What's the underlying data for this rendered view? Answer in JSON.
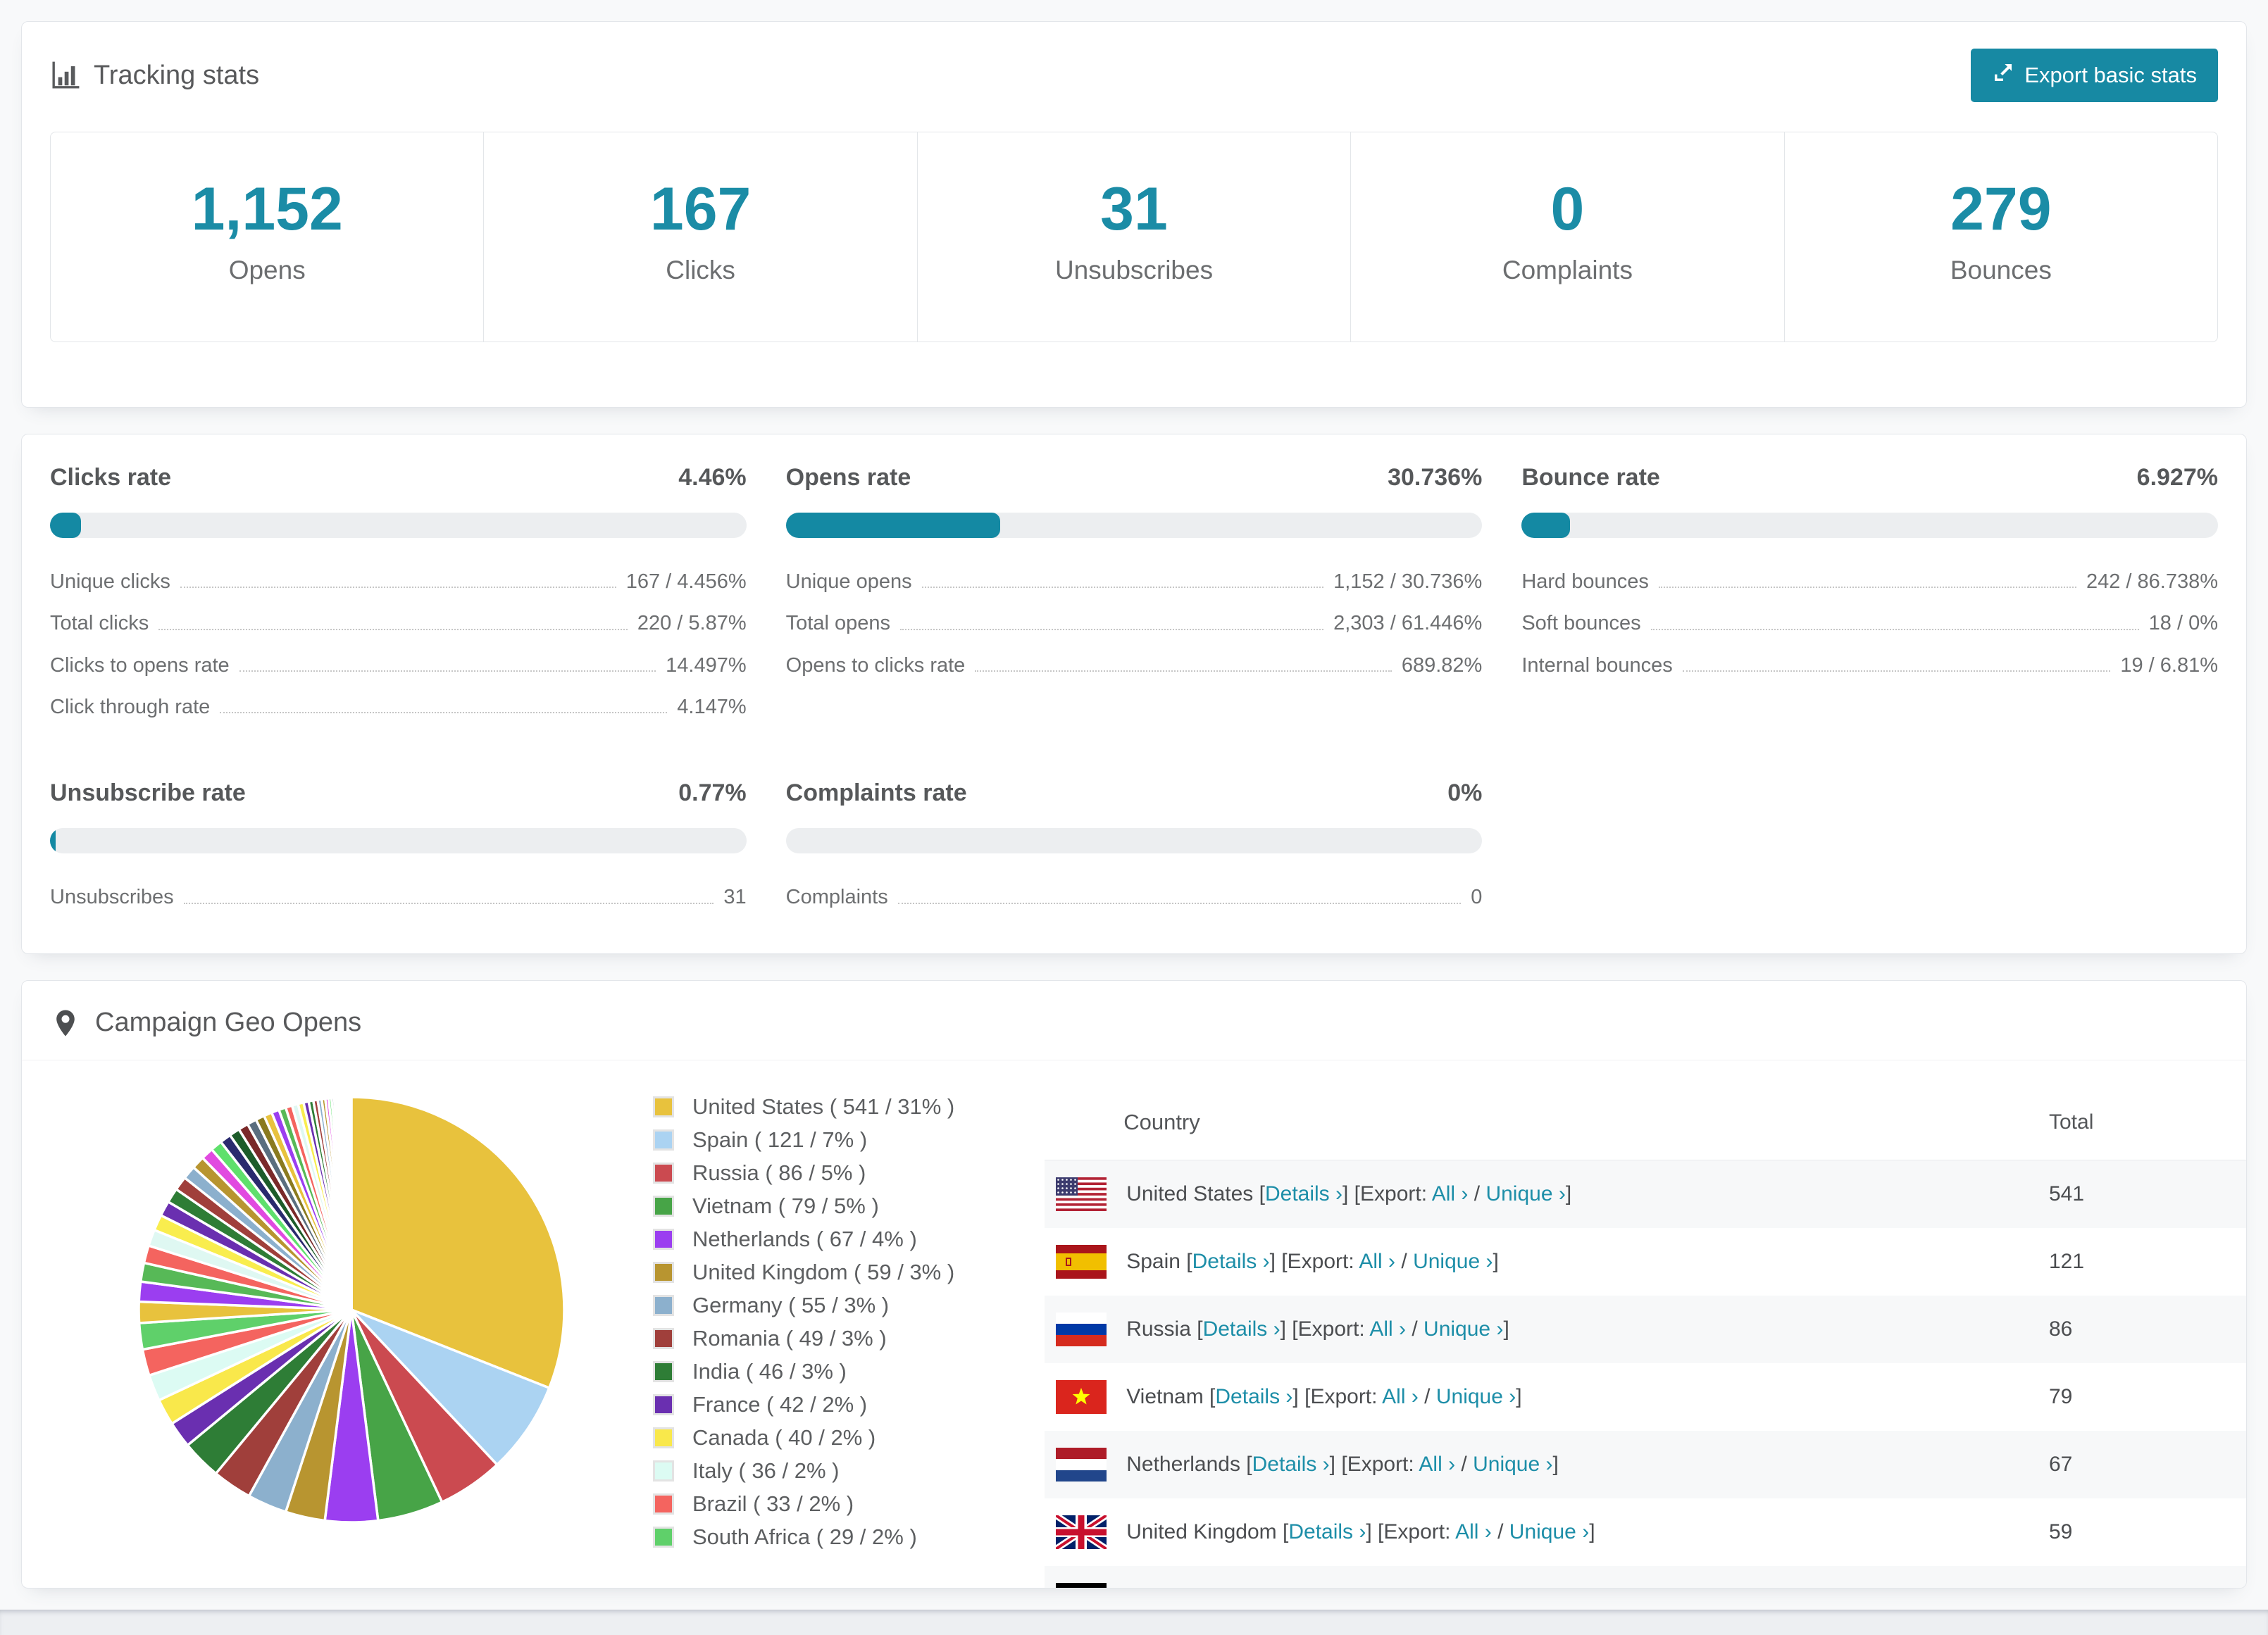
{
  "accent": "#1789a3",
  "tracking": {
    "title": "Tracking stats",
    "export_button": "Export basic stats",
    "summary": [
      {
        "value": "1,152",
        "label": "Opens"
      },
      {
        "value": "167",
        "label": "Clicks"
      },
      {
        "value": "31",
        "label": "Unsubscribes"
      },
      {
        "value": "0",
        "label": "Complaints"
      },
      {
        "value": "279",
        "label": "Bounces"
      }
    ]
  },
  "rates": [
    {
      "title": "Clicks rate",
      "value": "4.46%",
      "percent": 4.46,
      "rows": [
        {
          "label": "Unique clicks",
          "value": "167 / 4.456%"
        },
        {
          "label": "Total clicks",
          "value": "220 / 5.87%"
        },
        {
          "label": "Clicks to opens rate",
          "value": "14.497%"
        },
        {
          "label": "Click through rate",
          "value": "4.147%"
        }
      ]
    },
    {
      "title": "Opens rate",
      "value": "30.736%",
      "percent": 30.736,
      "rows": [
        {
          "label": "Unique opens",
          "value": "1,152 / 30.736%"
        },
        {
          "label": "Total opens",
          "value": "2,303 / 61.446%"
        },
        {
          "label": "Opens to clicks rate",
          "value": "689.82%"
        }
      ]
    },
    {
      "title": "Bounce rate",
      "value": "6.927%",
      "percent": 6.927,
      "rows": [
        {
          "label": "Hard bounces",
          "value": "242 / 86.738%"
        },
        {
          "label": "Soft bounces",
          "value": "18 / 0%"
        },
        {
          "label": "Internal bounces",
          "value": "19 / 6.81%"
        }
      ]
    },
    {
      "title": "Unsubscribe rate",
      "value": "0.77%",
      "percent": 0.77,
      "rows": [
        {
          "label": "Unsubscribes",
          "value": "31"
        }
      ]
    },
    {
      "title": "Complaints rate",
      "value": "0%",
      "percent": 0,
      "rows": [
        {
          "label": "Complaints",
          "value": "0"
        }
      ]
    }
  ],
  "geo": {
    "title": "Campaign Geo Opens",
    "columns": {
      "country": "Country",
      "total": "Total"
    },
    "links": {
      "open": " [",
      "close": "]",
      "details": "Details ›",
      "export": "Export: ",
      "all": "All ›",
      "sep": " / ",
      "unique": "Unique ›"
    },
    "rows": [
      {
        "country": "United States",
        "flag": "us",
        "total": "541",
        "partial": false
      },
      {
        "country": "Spain",
        "flag": "es",
        "total": "121",
        "partial": false
      },
      {
        "country": "Russia",
        "flag": "ru",
        "total": "86",
        "partial": false
      },
      {
        "country": "Vietnam",
        "flag": "vn",
        "total": "79",
        "partial": false
      },
      {
        "country": "Netherlands",
        "flag": "nl",
        "total": "67",
        "partial": false
      },
      {
        "country": "United Kingdom",
        "flag": "gb",
        "total": "59",
        "partial": false
      },
      {
        "country": "",
        "flag": "de",
        "total": "",
        "partial": true
      }
    ]
  },
  "chart_data": {
    "type": "pie",
    "title": "Campaign Geo Opens",
    "start_angle_deg": 0,
    "direction": "clockwise",
    "legend_position": "right",
    "slices": [
      {
        "label": "United States",
        "count": 541,
        "pct": 31,
        "color": "#e8c23d"
      },
      {
        "label": "Spain",
        "count": 121,
        "pct": 7,
        "color": "#abd3f2"
      },
      {
        "label": "Russia",
        "count": 86,
        "pct": 5,
        "color": "#cb4a50"
      },
      {
        "label": "Vietnam",
        "count": 79,
        "pct": 5,
        "color": "#47a447"
      },
      {
        "label": "Netherlands",
        "count": 67,
        "pct": 4,
        "color": "#9b3ef0"
      },
      {
        "label": "United Kingdom",
        "count": 59,
        "pct": 3,
        "color": "#b89530"
      },
      {
        "label": "Germany",
        "count": 55,
        "pct": 3,
        "color": "#8cb0cd"
      },
      {
        "label": "Romania",
        "count": 49,
        "pct": 3,
        "color": "#a03f3b"
      },
      {
        "label": "India",
        "count": 46,
        "pct": 3,
        "color": "#2e7d36"
      },
      {
        "label": "France",
        "count": 42,
        "pct": 2,
        "color": "#6a2fb0"
      },
      {
        "label": "Canada",
        "count": 40,
        "pct": 2,
        "color": "#f9e84b"
      },
      {
        "label": "Italy",
        "count": 36,
        "pct": 2,
        "color": "#dcfbf3"
      },
      {
        "label": "Brazil",
        "count": 33,
        "pct": 2,
        "color": "#f4645f"
      },
      {
        "label": "South Africa",
        "count": 29,
        "pct": 2,
        "color": "#5fd06a"
      }
    ],
    "others": {
      "note": "many unlabeled small-country slices totaling ~26% of opens",
      "weights": [
        1.8,
        1.7,
        1.6,
        1.5,
        1.4,
        1.35,
        1.3,
        1.25,
        1.2,
        1.15,
        1.1,
        1.05,
        1.0,
        0.95,
        0.9,
        0.85,
        0.8,
        0.75,
        0.7,
        0.65,
        0.6,
        0.56,
        0.52,
        0.48,
        0.44,
        0.4,
        0.37,
        0.34,
        0.31,
        0.28,
        0.25,
        0.22,
        0.2,
        0.18,
        0.16,
        0.14,
        0.12,
        0.1,
        0.09,
        0.08,
        0.07,
        0.06,
        0.05,
        0.045,
        0.04,
        0.035,
        0.03,
        0.025,
        0.02,
        0.015
      ],
      "colors": [
        "#e8c23d",
        "#9b3ef0",
        "#57b957",
        "#f4645f",
        "#dff8f2",
        "#f9ed4e",
        "#6a2fb0",
        "#2e7d36",
        "#a03f3b",
        "#8cb0cd",
        "#b89530",
        "#e14ae0",
        "#5fe06c",
        "#2a2a6e",
        "#1d5c2a",
        "#7a2929",
        "#5a6e7f",
        "#8a7a1f"
      ]
    }
  }
}
